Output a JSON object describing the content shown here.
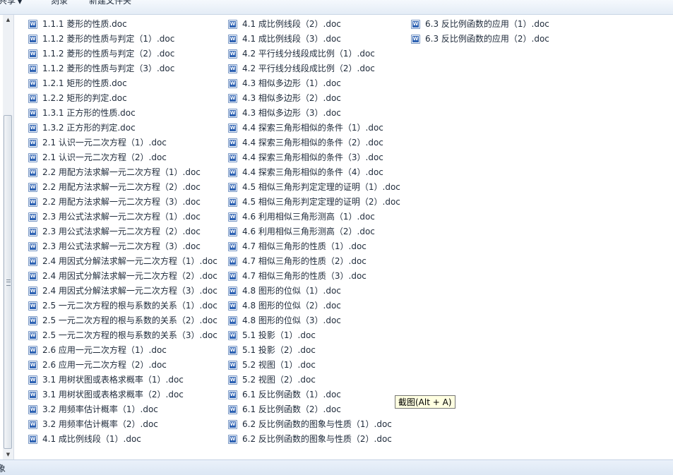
{
  "toolbar": {
    "share_label": "共享",
    "burn_label": "刻录",
    "new_folder_label": "新建文件夹"
  },
  "files": {
    "column1": [
      "1.1.1 菱形的性质.doc",
      "1.1.2 菱形的性质与判定（1）.doc",
      "1.1.2 菱形的性质与判定（2）.doc",
      "1.1.2 菱形的性质与判定（3）.doc",
      "1.2.1 矩形的性质.doc",
      "1.2.2 矩形的判定.doc",
      "1.3.1 正方形的性质.doc",
      "1.3.2 正方形的判定.doc",
      "2.1 认识一元二次方程（1）.doc",
      "2.1 认识一元二次方程（2）.doc",
      "2.2 用配方法求解一元二次方程（1）.doc",
      "2.2 用配方法求解一元二次方程（2）.doc",
      "2.2 用配方法求解一元二次方程（3）.doc",
      "2.3 用公式法求解一元二次方程（1）.doc",
      "2.3 用公式法求解一元二次方程（2）.doc",
      "2.3 用公式法求解一元二次方程（3）.doc",
      "2.4 用因式分解法求解一元二次方程（1）.doc",
      "2.4 用因式分解法求解一元二次方程（2）.doc",
      "2.4 用因式分解法求解一元二次方程（3）.doc",
      "2.5 一元二次方程的根与系数的关系（1）.doc",
      "2.5 一元二次方程的根与系数的关系（2）.doc",
      "2.5 一元二次方程的根与系数的关系（3）.doc",
      "2.6 应用一元二次方程（1）.doc",
      "2.6 应用一元二次方程（2）.doc",
      "3.1 用树状图或表格求概率（1）.doc",
      "3.1 用树状图或表格求概率（2）.doc",
      "3.2 用频率估计概率（1）.doc",
      "3.2 用频率估计概率（2）.doc",
      "4.1 成比例线段（1）.doc"
    ],
    "column2": [
      "4.1 成比例线段（2）.doc",
      "4.1 成比例线段（3）.doc",
      "4.2 平行线分线段成比例（1）.doc",
      "4.2 平行线分线段成比例（2）.doc",
      "4.3 相似多边形（1）.doc",
      "4.3 相似多边形（2）.doc",
      "4.3 相似多边形（3）.doc",
      "4.4 探索三角形相似的条件（1）.doc",
      "4.4 探索三角形相似的条件（2）.doc",
      "4.4 探索三角形相似的条件（3）.doc",
      "4.4 探索三角形相似的条件（4）.doc",
      "4.5 相似三角形判定定理的证明（1）.doc",
      "4.5 相似三角形判定定理的证明（2）.doc",
      "4.6 利用相似三角形测高（1）.doc",
      "4.6 利用相似三角形测高（2）.doc",
      "4.7 相似三角形的性质（1）.doc",
      "4.7 相似三角形的性质（2）.doc",
      "4.7 相似三角形的性质（3）.doc",
      "4.8 图形的位似（1）.doc",
      "4.8 图形的位似（2）.doc",
      "4.8 图形的位似（3）.doc",
      "5.1 投影（1）.doc",
      "5.1 投影（2）.doc",
      "5.2 视图（1）.doc",
      "5.2 视图（2）.doc",
      "6.1 反比例函数（1）.doc",
      "6.1 反比例函数（2）.doc",
      "6.2 反比例函数的图象与性质（1）.doc",
      "6.2 反比例函数的图象与性质（2）.doc"
    ],
    "column3": [
      "6.3 反比例函数的应用（1）.doc",
      "6.3 反比例函数的应用（2）.doc"
    ]
  },
  "tooltip": {
    "text": "截图(Alt + A)"
  },
  "status": {
    "text": "象"
  }
}
